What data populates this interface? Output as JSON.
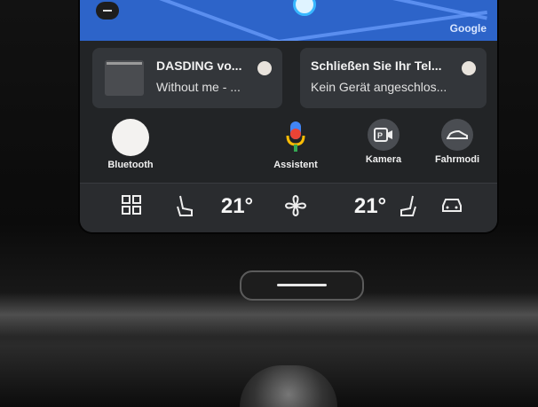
{
  "map": {
    "attribution": "Google"
  },
  "cards": [
    {
      "title": "DASDING vo...",
      "subtitle": "Without me - ..."
    },
    {
      "title": "Schließen Sie Ihr Tel...",
      "subtitle": "Kein Gerät angeschlos..."
    }
  ],
  "apps": {
    "bluetooth": "Bluetooth",
    "assistant": "Assistent",
    "camera": "Kamera",
    "drive_modes": "Fahrmodi"
  },
  "climate": {
    "left_temp": "21°",
    "right_temp": "21°"
  },
  "colors": {
    "map": "#2d64c9",
    "screen": "#222426",
    "card": "#33363a"
  }
}
